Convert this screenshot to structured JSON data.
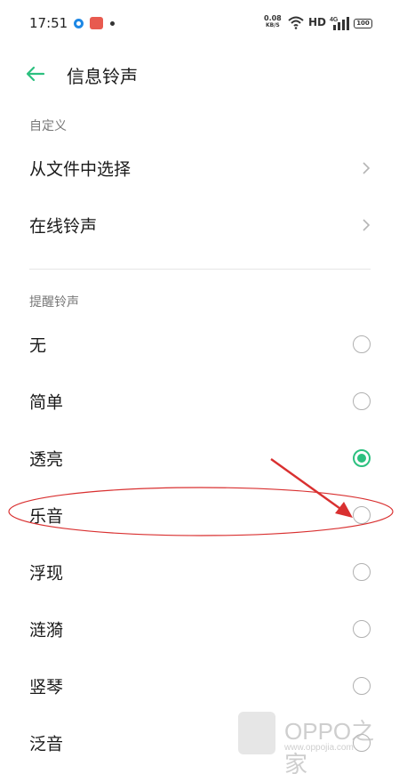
{
  "status_bar": {
    "time": "17:51",
    "net_speed_value": "0.08",
    "net_speed_unit": "KB/S",
    "hd": "HD",
    "signal": "4G",
    "battery": "100",
    "accent_blue": "#1e88e5",
    "notification_red": "#e85a4f"
  },
  "header": {
    "back_icon": "arrow-left-icon",
    "title": "信息铃声",
    "accent": "#2cc07f"
  },
  "custom_section": {
    "header": "自定义",
    "items": [
      {
        "label": "从文件中选择",
        "icon": "chevron-right-icon"
      },
      {
        "label": "在线铃声",
        "icon": "chevron-right-icon"
      }
    ]
  },
  "ringtone_section": {
    "header": "提醒铃声",
    "selected_color": "#2cc07f",
    "items": [
      {
        "label": "无",
        "selected": false
      },
      {
        "label": "简单",
        "selected": false
      },
      {
        "label": "透亮",
        "selected": true
      },
      {
        "label": "乐音",
        "selected": false
      },
      {
        "label": "浮现",
        "selected": false
      },
      {
        "label": "涟漪",
        "selected": false
      },
      {
        "label": "竖琴",
        "selected": false
      },
      {
        "label": "泛音",
        "selected": false
      }
    ]
  },
  "annotation": {
    "color": "#d93030",
    "highlighted_item": "乐音"
  },
  "watermark": {
    "text": "OPPO之家",
    "url": "www.oppojia.com"
  }
}
